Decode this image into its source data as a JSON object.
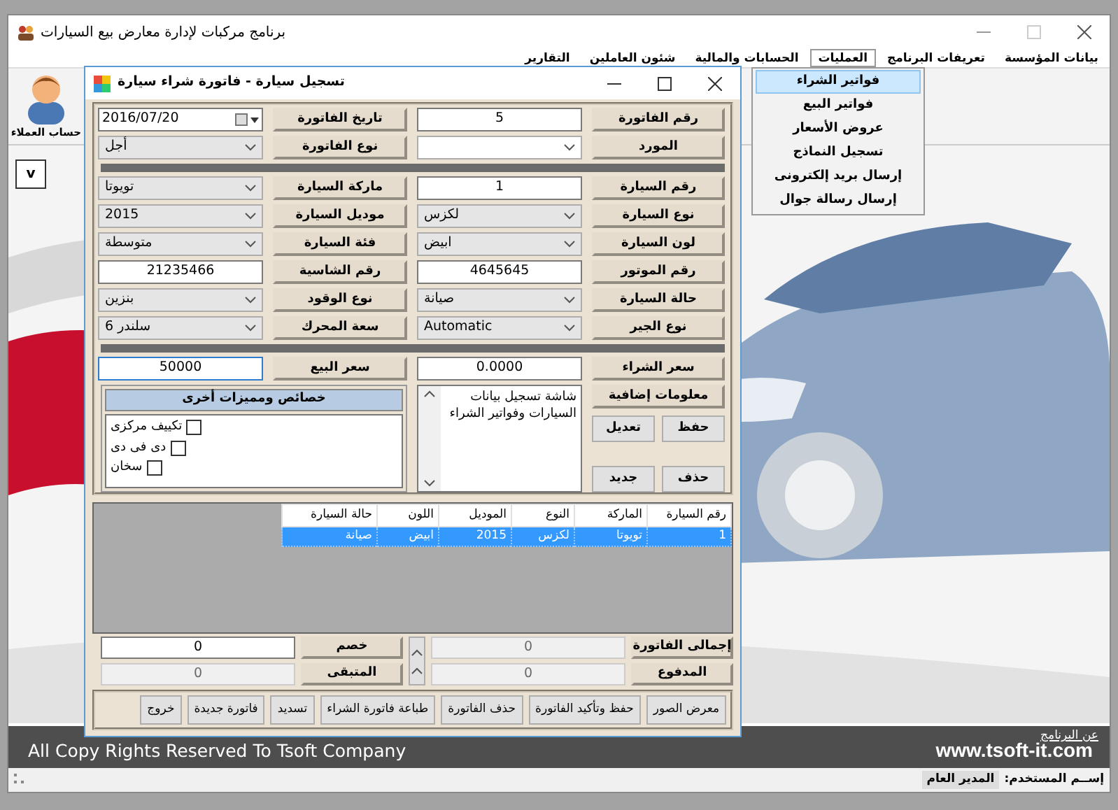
{
  "window": {
    "title": "برنامج مركبات لإدارة معارض بيع السيارات"
  },
  "menu": [
    {
      "label": "بيانات المؤسسة",
      "selected": false
    },
    {
      "label": "تعريفات البرنامج",
      "selected": false
    },
    {
      "label": "العمليات",
      "selected": true
    },
    {
      "label": "الحسابات والمالية",
      "selected": false
    },
    {
      "label": "شئون العاملين",
      "selected": false
    },
    {
      "label": "التقارير",
      "selected": false
    }
  ],
  "dropdown": [
    {
      "label": "فواتير الشراء",
      "selected": true
    },
    {
      "label": "فواتير البيع",
      "selected": false
    },
    {
      "label": "عروض الأسعار",
      "selected": false
    },
    {
      "label": "تسجيل النماذج",
      "selected": false
    },
    {
      "label": "إرسال بريد إلكترونى",
      "selected": false
    },
    {
      "label": "إرسال رسالة جوال",
      "selected": false
    }
  ],
  "toolbar": [
    {
      "label": "حساب العملاء"
    }
  ],
  "small_button": "v",
  "dialog": {
    "title": "تسجيل سيارة - فاتورة شراء سيارة",
    "invoice_fields": [
      {
        "label": "رقم الفاتورة",
        "kind": "text",
        "value": "5"
      },
      {
        "label": "تاريخ الفاتورة",
        "kind": "date",
        "value": "2016/07/20"
      },
      {
        "label": "المورد",
        "kind": "combo"
      },
      {
        "label": "نوع الفاتورة",
        "kind": "combo",
        "value": "أجل"
      }
    ],
    "car_fields": [
      {
        "label": "رقم السيارة",
        "kind": "text",
        "value": "1"
      },
      {
        "label": "ماركة السيارة",
        "kind": "combo",
        "value": "تويوتا"
      },
      {
        "label": "نوع السيارة",
        "kind": "combo",
        "value": "لكزس"
      },
      {
        "label": "موديل السيارة",
        "kind": "combo",
        "value": "2015"
      },
      {
        "label": "لون السيارة",
        "kind": "combo",
        "value": "ابيض"
      },
      {
        "label": "فئة السيارة",
        "kind": "combo",
        "value": "متوسطة"
      },
      {
        "label": "رقم الموتور",
        "kind": "text",
        "value": "4645645"
      },
      {
        "label": "رقم الشاسية",
        "kind": "text",
        "value": "21235466"
      },
      {
        "label": "حالة السيارة",
        "kind": "combo",
        "value": "صيانة"
      },
      {
        "label": "نوع الوقود",
        "kind": "combo",
        "value": "بنزين"
      },
      {
        "label": "نوع الجير",
        "kind": "combo",
        "value": "Automatic"
      },
      {
        "label": "سعة المحرك",
        "kind": "combo",
        "value": "سلندر 6"
      }
    ],
    "price_fields": [
      {
        "label": "سعر الشراء",
        "value": "0.0000",
        "focused": false
      },
      {
        "label": "سعر البيع",
        "value": "50000",
        "focused": true
      }
    ],
    "notes": {
      "label": "معلومات إضافية",
      "text": "شاشة تسجيل بيانات السيارات وفواتير الشراء"
    },
    "action_buttons": [
      "حفظ",
      "تعديل",
      "حذف",
      "جديد"
    ],
    "features": {
      "title": "خصائص ومميزات أخرى",
      "items": [
        {
          "label": "تكييف مركزى",
          "checked": false
        },
        {
          "label": "دى فى دى",
          "checked": false
        },
        {
          "label": "سخان",
          "checked": false
        }
      ]
    },
    "table": {
      "columns": [
        "رقم السيارة",
        "الماركة",
        "النوع",
        "الموديل",
        "اللون",
        "حالة السيارة"
      ],
      "rows": [
        {
          "cells": [
            "1",
            "تويوتا",
            "لكزس",
            "2015",
            "ابيض",
            "صيانة"
          ],
          "selected": true
        }
      ]
    },
    "totals": [
      {
        "label": "إجمالى الفاتورة",
        "value": "0",
        "disabled": true
      },
      {
        "label": "خصم",
        "value": "0",
        "disabled": false
      },
      {
        "label": "المدفوع",
        "value": "0",
        "disabled": true
      },
      {
        "label": "المتبقى",
        "value": "0",
        "disabled": true
      }
    ],
    "buttons": [
      "معرض الصور",
      "حفظ وتأكيد الفاتورة",
      "حذف الفاتورة",
      "طباعة فاتورة الشراء",
      "تسديد",
      "فاتورة جديدة",
      "خروج"
    ]
  },
  "footer": {
    "about_link": "عن البرنامج",
    "copyright": "All Copy Rights Reserved To Tsoft Company",
    "website": "www.tsoft-it.com"
  },
  "status_bar": {
    "user_label": "إســم المستخدم:",
    "user": "المدير العام"
  }
}
